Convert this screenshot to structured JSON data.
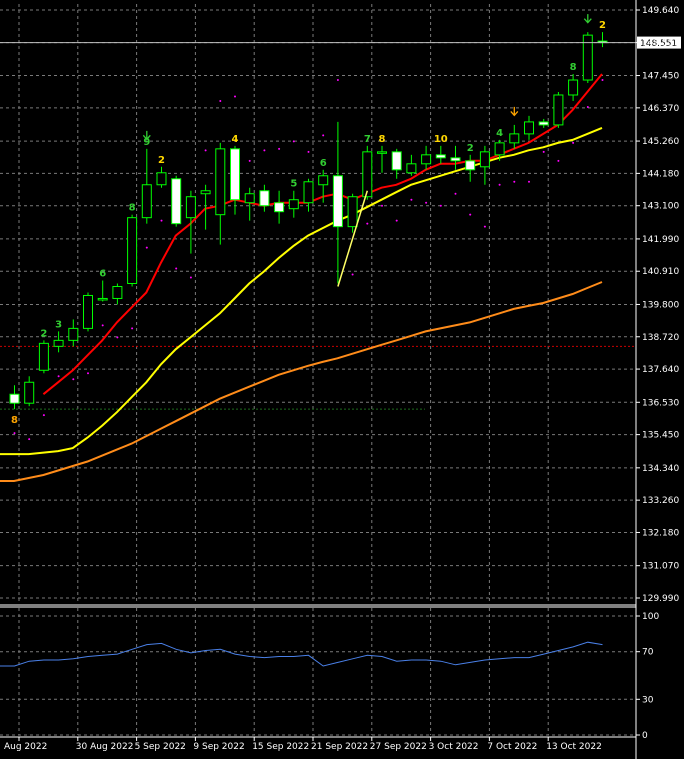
{
  "chart_data": {
    "type": "candlestick",
    "price_axis": {
      "ticks": [
        149.64,
        148.551,
        147.45,
        146.37,
        145.26,
        144.18,
        143.1,
        141.99,
        140.91,
        139.8,
        138.72,
        137.64,
        136.53,
        135.45,
        134.34,
        133.26,
        132.18,
        131.07,
        129.99
      ],
      "range": [
        129.99,
        149.64
      ],
      "current_price": "148.551"
    },
    "time_axis": {
      "labels": [
        "Aug 2022",
        "30 Aug 2022",
        "5 Sep 2022",
        "9 Sep 2022",
        "15 Sep 2022",
        "21 Sep 2022",
        "27 Sep 2022",
        "3 Oct 2022",
        "7 Oct 2022",
        "13 Oct 2022"
      ],
      "label_bar_index": [
        0,
        4,
        8,
        12,
        16,
        20,
        24,
        28,
        32,
        36
      ]
    },
    "candles": [
      {
        "o": 136.8,
        "h": 137.1,
        "l": 136.3,
        "c": 136.5
      },
      {
        "o": 136.5,
        "h": 137.4,
        "l": 136.4,
        "c": 137.2
      },
      {
        "o": 137.6,
        "h": 138.6,
        "l": 137.5,
        "c": 138.5
      },
      {
        "o": 138.4,
        "h": 138.9,
        "l": 138.2,
        "c": 138.6
      },
      {
        "o": 138.6,
        "h": 139.3,
        "l": 138.4,
        "c": 139.0
      },
      {
        "o": 139.0,
        "h": 140.2,
        "l": 138.9,
        "c": 140.1
      },
      {
        "o": 140.0,
        "h": 140.6,
        "l": 139.9,
        "c": 140.0
      },
      {
        "o": 140.0,
        "h": 140.5,
        "l": 139.8,
        "c": 140.4
      },
      {
        "o": 140.5,
        "h": 142.8,
        "l": 140.4,
        "c": 142.7
      },
      {
        "o": 142.7,
        "h": 145.0,
        "l": 142.5,
        "c": 143.8
      },
      {
        "o": 143.8,
        "h": 144.4,
        "l": 143.7,
        "c": 144.2
      },
      {
        "o": 144.0,
        "h": 144.1,
        "l": 142.4,
        "c": 142.5
      },
      {
        "o": 142.7,
        "h": 143.6,
        "l": 141.5,
        "c": 143.4
      },
      {
        "o": 143.5,
        "h": 143.8,
        "l": 142.3,
        "c": 143.6
      },
      {
        "o": 142.8,
        "h": 145.2,
        "l": 141.8,
        "c": 145.0
      },
      {
        "o": 145.0,
        "h": 145.1,
        "l": 142.8,
        "c": 143.3
      },
      {
        "o": 143.2,
        "h": 143.7,
        "l": 142.6,
        "c": 143.5
      },
      {
        "o": 143.6,
        "h": 143.8,
        "l": 142.9,
        "c": 143.1
      },
      {
        "o": 143.2,
        "h": 143.6,
        "l": 142.5,
        "c": 142.9
      },
      {
        "o": 143.0,
        "h": 143.6,
        "l": 142.7,
        "c": 143.3
      },
      {
        "o": 143.2,
        "h": 144.0,
        "l": 142.9,
        "c": 143.9
      },
      {
        "o": 143.8,
        "h": 144.3,
        "l": 143.2,
        "c": 144.1
      },
      {
        "o": 144.1,
        "h": 145.9,
        "l": 140.5,
        "c": 142.4
      },
      {
        "o": 142.4,
        "h": 143.5,
        "l": 142.2,
        "c": 143.4
      },
      {
        "o": 143.4,
        "h": 145.1,
        "l": 143.3,
        "c": 144.9
      },
      {
        "o": 144.9,
        "h": 145.1,
        "l": 144.2,
        "c": 144.9
      },
      {
        "o": 144.9,
        "h": 145.0,
        "l": 144.0,
        "c": 144.3
      },
      {
        "o": 144.2,
        "h": 144.8,
        "l": 144.1,
        "c": 144.5
      },
      {
        "o": 144.5,
        "h": 145.1,
        "l": 144.3,
        "c": 144.8
      },
      {
        "o": 144.8,
        "h": 145.1,
        "l": 144.5,
        "c": 144.7
      },
      {
        "o": 144.7,
        "h": 145.1,
        "l": 144.3,
        "c": 144.6
      },
      {
        "o": 144.6,
        "h": 144.8,
        "l": 143.9,
        "c": 144.3
      },
      {
        "o": 144.4,
        "h": 145.1,
        "l": 143.8,
        "c": 144.9
      },
      {
        "o": 144.8,
        "h": 145.3,
        "l": 144.6,
        "c": 145.2
      },
      {
        "o": 145.2,
        "h": 145.8,
        "l": 145.0,
        "c": 145.5
      },
      {
        "o": 145.5,
        "h": 146.1,
        "l": 145.3,
        "c": 145.9
      },
      {
        "o": 145.9,
        "h": 146.0,
        "l": 145.7,
        "c": 145.8
      },
      {
        "o": 145.8,
        "h": 146.9,
        "l": 145.7,
        "c": 146.8
      },
      {
        "o": 146.8,
        "h": 147.5,
        "l": 146.6,
        "c": 147.3
      },
      {
        "o": 147.3,
        "h": 148.9,
        "l": 147.2,
        "c": 148.8
      },
      {
        "o": 148.6,
        "h": 148.9,
        "l": 148.4,
        "c": 148.55
      }
    ],
    "moving_averages": [
      {
        "color": "#ff0000",
        "values": [
          null,
          null,
          136.8,
          137.2,
          137.6,
          138.1,
          138.6,
          139.2,
          139.7,
          140.2,
          141.2,
          142.1,
          142.5,
          143.0,
          143.1,
          143.3,
          143.2,
          143.1,
          143.2,
          143.2,
          143.2,
          143.4,
          143.5,
          143.3,
          143.5,
          143.7,
          143.8,
          144.0,
          144.3,
          144.5,
          144.5,
          144.6,
          144.6,
          144.8,
          145.0,
          145.2,
          145.5,
          145.8,
          146.3,
          146.9,
          147.5
        ]
      },
      {
        "color": "#ffff00",
        "values": [
          134.8,
          134.8,
          134.85,
          134.9,
          135.0,
          135.35,
          135.75,
          136.2,
          136.7,
          137.2,
          137.8,
          138.3,
          138.7,
          139.1,
          139.5,
          140.0,
          140.5,
          140.9,
          141.35,
          141.75,
          142.1,
          142.35,
          142.6,
          142.8,
          143.05,
          143.3,
          143.55,
          143.8,
          143.95,
          144.1,
          144.25,
          144.4,
          144.55,
          144.7,
          144.8,
          144.95,
          145.05,
          145.2,
          145.3,
          145.5,
          145.7
        ]
      },
      {
        "color": "#ff8c1a",
        "values": [
          133.9,
          134.0,
          134.1,
          134.25,
          134.4,
          134.55,
          134.75,
          134.95,
          135.15,
          135.4,
          135.65,
          135.9,
          136.15,
          136.4,
          136.65,
          136.85,
          137.05,
          137.25,
          137.45,
          137.6,
          137.75,
          137.88,
          138.0,
          138.15,
          138.3,
          138.45,
          138.6,
          138.75,
          138.9,
          139.0,
          139.1,
          139.2,
          139.35,
          139.5,
          139.65,
          139.75,
          139.85,
          140.0,
          140.15,
          140.35,
          140.55
        ]
      }
    ],
    "sar_dots_color": "#ff00ff",
    "count_labels": [
      {
        "bar": 0,
        "text": "8",
        "color": "#ffa500",
        "pos": "below"
      },
      {
        "bar": 2,
        "text": "2",
        "color": "#32cd32",
        "pos": "above"
      },
      {
        "bar": 3,
        "text": "3",
        "color": "#32cd32",
        "pos": "above"
      },
      {
        "bar": 6,
        "text": "6",
        "color": "#32cd32",
        "pos": "above"
      },
      {
        "bar": 8,
        "text": "8",
        "color": "#32cd32",
        "pos": "above"
      },
      {
        "bar": 9,
        "text": "9",
        "color": "#32cd32",
        "pos": "above"
      },
      {
        "bar": 10,
        "text": "2",
        "color": "#ffd700",
        "pos": "above"
      },
      {
        "bar": 15,
        "text": "4",
        "color": "#ffd700",
        "pos": "above"
      },
      {
        "bar": 19,
        "text": "5",
        "color": "#32cd32",
        "pos": "above"
      },
      {
        "bar": 21,
        "text": "6",
        "color": "#32cd32",
        "pos": "above"
      },
      {
        "bar": 24,
        "text": "7",
        "color": "#32cd32",
        "pos": "above"
      },
      {
        "bar": 25,
        "text": "8",
        "color": "#ffd700",
        "pos": "above"
      },
      {
        "bar": 29,
        "text": "10",
        "color": "#ffd700",
        "pos": "above"
      },
      {
        "bar": 31,
        "text": "2",
        "color": "#32cd32",
        "pos": "above"
      },
      {
        "bar": 33,
        "text": "4",
        "color": "#32cd32",
        "pos": "above"
      },
      {
        "bar": 38,
        "text": "8",
        "color": "#32cd32",
        "pos": "above"
      },
      {
        "bar": 40,
        "text": "2",
        "color": "#ffd700",
        "pos": "above"
      }
    ],
    "arrows": [
      {
        "bar": 9,
        "color": "#32cd32"
      },
      {
        "bar": 34,
        "color": "#ffa500"
      },
      {
        "bar": 39,
        "color": "#32cd32"
      }
    ],
    "horizontal_lines": [
      {
        "price": 138.4,
        "color": "#cc0000"
      },
      {
        "price": 136.3,
        "color": "#1e6b1e"
      }
    ],
    "trend_line": {
      "from_bar": 22,
      "from_price": 140.4,
      "to_bar": 24,
      "to_price": 143.6,
      "color": "#ffff66"
    },
    "oscillator": {
      "ticks": [
        100,
        70,
        30,
        0
      ],
      "range": [
        0,
        100
      ],
      "color": "#4a80e8",
      "values": [
        58,
        62,
        63,
        63,
        64,
        66,
        67,
        68,
        72,
        76,
        77,
        72,
        69,
        71,
        72,
        68,
        66,
        65,
        66,
        66,
        67,
        58,
        61,
        64,
        67,
        66,
        62,
        63,
        63,
        62,
        59,
        61,
        63,
        64,
        65,
        65,
        68,
        71,
        74,
        78,
        76
      ]
    }
  }
}
